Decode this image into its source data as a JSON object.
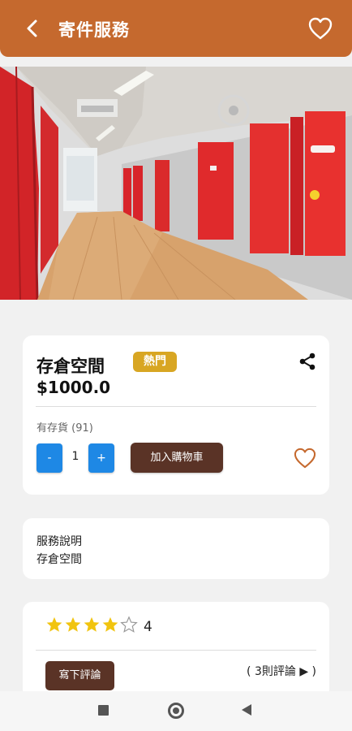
{
  "appbar": {
    "title": "寄件服務",
    "color": "#c5692e"
  },
  "hero": {
    "description_icon": "storage-corridor-image"
  },
  "product": {
    "name": "存倉空間",
    "badge": "熱門",
    "badge_color": "#d8a623",
    "price": "$1000.0",
    "stock": "有存貨 (91)",
    "qty_minus": "-",
    "quantity": "1",
    "qty_plus": "+",
    "add_to_cart": "加入購物車",
    "button_color": "#5a3326",
    "stepper_color": "#1e88e5"
  },
  "description": {
    "label": "服務說明",
    "text": "存倉空間"
  },
  "reviews": {
    "stars_filled": 4,
    "stars_total": 5,
    "rating": "4",
    "write_label": "寫下評論",
    "count_label": "( 3則評論 ▶ )",
    "star_color": "#f1c40f"
  }
}
